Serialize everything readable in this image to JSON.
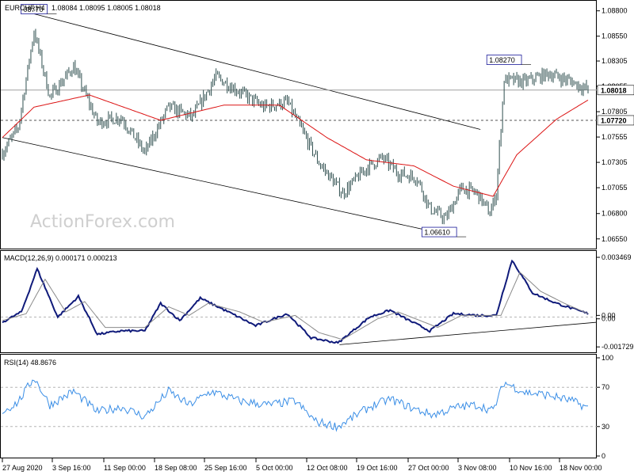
{
  "header": {
    "symbol": "EURCHF,H4",
    "ohlc": "1.08084 1.08095 1.08005 1.08018"
  },
  "watermark": "ActionForex.com",
  "colors": {
    "bars": "#2f4f4f",
    "ma": "#dc1414",
    "macd": "#0f1a7a",
    "macd_signal": "#8a8a8a",
    "rsi": "#3a8ee6",
    "grid": "#b5b5b5",
    "channel": "#000000",
    "tag_border": "#1a1a99"
  },
  "chart_data": [
    {
      "type": "candlestick",
      "title": "EURCHF,H4 1.08084 1.08095 1.08005 1.08018",
      "x_tick_labels": [
        "27 Aug 2020",
        "3 Sep 16:00",
        "11 Sep 00:00",
        "18 Sep 08:00",
        "25 Sep 16:00",
        "5 Oct 00:00",
        "12 Oct 08:00",
        "19 Oct 16:00",
        "27 Oct 00:00",
        "3 Nov 08:00",
        "10 Nov 16:00",
        "18 Nov 00:00"
      ],
      "y_tick_labels": [
        "1.08800",
        "1.08550",
        "1.08305",
        "1.08055",
        "1.07805",
        "1.07555",
        "1.07305",
        "1.07055",
        "1.06800",
        "1.06550"
      ],
      "ylim": [
        1.0647,
        1.0886
      ],
      "annotations": [
        {
          "label": "1.08770",
          "display": "08770",
          "value": 1.0877,
          "bar": 20
        },
        {
          "label": "1.08270",
          "display": "1.08270",
          "value": 1.0827,
          "bar": 317
        },
        {
          "label": "1.06610",
          "display": "1.06610",
          "value": 1.0661,
          "bar": 276
        }
      ],
      "horizontal_lines": [
        {
          "label": "1.08018",
          "value": 1.08018,
          "style": "solid"
        },
        {
          "label": "1.07720",
          "value": 1.0772,
          "style": "dashed"
        }
      ],
      "moving_average_keypoints": [
        {
          "bar": 0,
          "value": 1.0755
        },
        {
          "bar": 20,
          "value": 1.0785
        },
        {
          "bar": 55,
          "value": 1.0797
        },
        {
          "bar": 100,
          "value": 1.0772
        },
        {
          "bar": 140,
          "value": 1.0787
        },
        {
          "bar": 175,
          "value": 1.0787
        },
        {
          "bar": 205,
          "value": 1.0755
        },
        {
          "bar": 230,
          "value": 1.0733
        },
        {
          "bar": 260,
          "value": 1.0727
        },
        {
          "bar": 285,
          "value": 1.0707
        },
        {
          "bar": 310,
          "value": 1.0697
        },
        {
          "bar": 325,
          "value": 1.0738
        },
        {
          "bar": 350,
          "value": 1.0773
        },
        {
          "bar": 370,
          "value": 1.0792
        }
      ],
      "price_keypoints": [
        {
          "bar": 0,
          "value": 1.074
        },
        {
          "bar": 10,
          "value": 1.0765
        },
        {
          "bar": 20,
          "value": 1.086
        },
        {
          "bar": 30,
          "value": 1.0795
        },
        {
          "bar": 45,
          "value": 1.0825
        },
        {
          "bar": 60,
          "value": 1.077
        },
        {
          "bar": 75,
          "value": 1.0775
        },
        {
          "bar": 90,
          "value": 1.074
        },
        {
          "bar": 105,
          "value": 1.0785
        },
        {
          "bar": 120,
          "value": 1.0775
        },
        {
          "bar": 135,
          "value": 1.0815
        },
        {
          "bar": 150,
          "value": 1.08
        },
        {
          "bar": 165,
          "value": 1.0785
        },
        {
          "bar": 180,
          "value": 1.079
        },
        {
          "bar": 190,
          "value": 1.076
        },
        {
          "bar": 200,
          "value": 1.073
        },
        {
          "bar": 215,
          "value": 1.07
        },
        {
          "bar": 230,
          "value": 1.0725
        },
        {
          "bar": 240,
          "value": 1.0735
        },
        {
          "bar": 250,
          "value": 1.072
        },
        {
          "bar": 262,
          "value": 1.0715
        },
        {
          "bar": 270,
          "value": 1.0685
        },
        {
          "bar": 280,
          "value": 1.0675
        },
        {
          "bar": 290,
          "value": 1.0705
        },
        {
          "bar": 300,
          "value": 1.07
        },
        {
          "bar": 308,
          "value": 1.068
        },
        {
          "bar": 312,
          "value": 1.07
        },
        {
          "bar": 317,
          "value": 1.0812
        },
        {
          "bar": 330,
          "value": 1.081
        },
        {
          "bar": 345,
          "value": 1.0818
        },
        {
          "bar": 360,
          "value": 1.081
        },
        {
          "bar": 370,
          "value": 1.0802
        }
      ],
      "channel_lines": [
        {
          "from": {
            "bar": 20,
            "value": 1.0877
          },
          "to": {
            "bar": 302,
            "value": 1.0763
          }
        },
        {
          "from": {
            "bar": 0,
            "value": 1.0755
          },
          "to": {
            "bar": 276,
            "value": 1.0661
          }
        }
      ],
      "bar_count": 371
    },
    {
      "type": "line",
      "title": "MACD(12,26,9) 0.000171 0.000213",
      "y_tick_labels": [
        "0.003469",
        "0.00",
        "0.00",
        "-0.001729"
      ],
      "ylim": [
        -0.00195,
        0.0037
      ],
      "series": [
        {
          "name": "MACD",
          "keypoints": [
            {
              "bar": 0,
              "value": -0.0003
            },
            {
              "bar": 12,
              "value": 0.0003
            },
            {
              "bar": 22,
              "value": 0.0028
            },
            {
              "bar": 35,
              "value": 0.0
            },
            {
              "bar": 48,
              "value": 0.0012
            },
            {
              "bar": 60,
              "value": -0.001
            },
            {
              "bar": 75,
              "value": -0.0008
            },
            {
              "bar": 90,
              "value": -0.0008
            },
            {
              "bar": 100,
              "value": 0.0008
            },
            {
              "bar": 112,
              "value": -0.0002
            },
            {
              "bar": 125,
              "value": 0.0011
            },
            {
              "bar": 145,
              "value": 0.0002
            },
            {
              "bar": 160,
              "value": -0.0005
            },
            {
              "bar": 180,
              "value": 0.0002
            },
            {
              "bar": 195,
              "value": -0.0012
            },
            {
              "bar": 212,
              "value": -0.0015
            },
            {
              "bar": 232,
              "value": 0.0
            },
            {
              "bar": 245,
              "value": 0.0004
            },
            {
              "bar": 255,
              "value": -0.0001
            },
            {
              "bar": 270,
              "value": -0.0008
            },
            {
              "bar": 285,
              "value": 0.0002
            },
            {
              "bar": 300,
              "value": 0.0001
            },
            {
              "bar": 312,
              "value": 0.0001
            },
            {
              "bar": 322,
              "value": 0.0033
            },
            {
              "bar": 335,
              "value": 0.0014
            },
            {
              "bar": 350,
              "value": 0.0008
            },
            {
              "bar": 370,
              "value": 0.0002
            }
          ]
        },
        {
          "name": "Signal",
          "keypoints": [
            {
              "bar": 0,
              "value": -0.0002
            },
            {
              "bar": 15,
              "value": 0.0002
            },
            {
              "bar": 27,
              "value": 0.0022
            },
            {
              "bar": 40,
              "value": 0.0003
            },
            {
              "bar": 52,
              "value": 0.0009
            },
            {
              "bar": 65,
              "value": -0.0006
            },
            {
              "bar": 90,
              "value": -0.0006
            },
            {
              "bar": 105,
              "value": 0.0006
            },
            {
              "bar": 118,
              "value": 0.0001
            },
            {
              "bar": 130,
              "value": 0.0008
            },
            {
              "bar": 150,
              "value": 0.0003
            },
            {
              "bar": 165,
              "value": -0.0003
            },
            {
              "bar": 185,
              "value": 0.0001
            },
            {
              "bar": 200,
              "value": -0.0009
            },
            {
              "bar": 215,
              "value": -0.0013
            },
            {
              "bar": 237,
              "value": -0.0001
            },
            {
              "bar": 250,
              "value": 0.0003
            },
            {
              "bar": 275,
              "value": -0.0006
            },
            {
              "bar": 290,
              "value": 0.0001
            },
            {
              "bar": 315,
              "value": 0.0001
            },
            {
              "bar": 327,
              "value": 0.0026
            },
            {
              "bar": 340,
              "value": 0.0015
            },
            {
              "bar": 355,
              "value": 0.0008
            },
            {
              "bar": 370,
              "value": 0.0002
            }
          ]
        }
      ],
      "trend_line": {
        "from": {
          "bar": 213,
          "value": -0.0016
        },
        "to": {
          "bar": 380,
          "value": -0.0003
        }
      }
    },
    {
      "type": "line",
      "title": "RSI(14) 48.8676",
      "y_tick_labels": [
        "100",
        "70",
        "30",
        "0"
      ],
      "ylim": [
        0,
        100
      ],
      "levels": [
        70,
        30
      ],
      "series": [
        {
          "name": "RSI(14)",
          "keypoints": [
            {
              "bar": 0,
              "value": 45
            },
            {
              "bar": 10,
              "value": 55
            },
            {
              "bar": 20,
              "value": 80
            },
            {
              "bar": 30,
              "value": 52
            },
            {
              "bar": 45,
              "value": 66
            },
            {
              "bar": 60,
              "value": 45
            },
            {
              "bar": 75,
              "value": 50
            },
            {
              "bar": 90,
              "value": 40
            },
            {
              "bar": 105,
              "value": 66
            },
            {
              "bar": 118,
              "value": 52
            },
            {
              "bar": 132,
              "value": 66
            },
            {
              "bar": 150,
              "value": 56
            },
            {
              "bar": 168,
              "value": 52
            },
            {
              "bar": 185,
              "value": 56
            },
            {
              "bar": 198,
              "value": 35
            },
            {
              "bar": 212,
              "value": 30
            },
            {
              "bar": 232,
              "value": 50
            },
            {
              "bar": 245,
              "value": 58
            },
            {
              "bar": 260,
              "value": 48
            },
            {
              "bar": 272,
              "value": 42
            },
            {
              "bar": 288,
              "value": 50
            },
            {
              "bar": 300,
              "value": 52
            },
            {
              "bar": 310,
              "value": 46
            },
            {
              "bar": 317,
              "value": 75
            },
            {
              "bar": 330,
              "value": 65
            },
            {
              "bar": 345,
              "value": 62
            },
            {
              "bar": 360,
              "value": 56
            },
            {
              "bar": 370,
              "value": 49
            }
          ]
        }
      ]
    }
  ]
}
